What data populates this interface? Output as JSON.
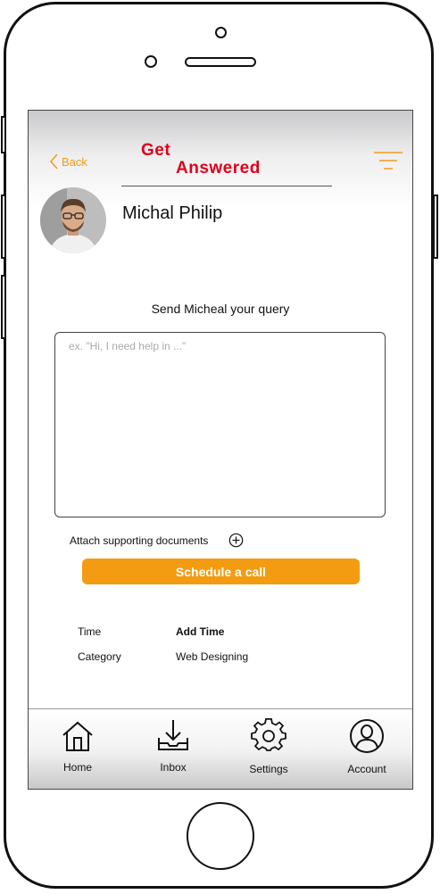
{
  "header": {
    "back_label": "Back",
    "title_line1": "Get",
    "title_line2": "Answered",
    "accent_color": "#f39c12",
    "title_color": "#e0001a"
  },
  "profile": {
    "name": "Michal Philip"
  },
  "query": {
    "prompt": "Send Micheal your query",
    "placeholder": "ex. \"Hi, I need help in ...\"",
    "value": ""
  },
  "attach": {
    "label": "Attach supporting documents",
    "icon": "plus-circle-icon"
  },
  "schedule": {
    "label": "Schedule a call"
  },
  "details": {
    "time_label": "Time",
    "time_value": "Add Time",
    "category_label": "Category",
    "category_value": "Web Designing"
  },
  "tabs": [
    {
      "label": "Home",
      "icon": "home-icon"
    },
    {
      "label": "Inbox",
      "icon": "inbox-icon"
    },
    {
      "label": "Settings",
      "icon": "gear-icon"
    },
    {
      "label": "Account",
      "icon": "account-icon"
    }
  ]
}
